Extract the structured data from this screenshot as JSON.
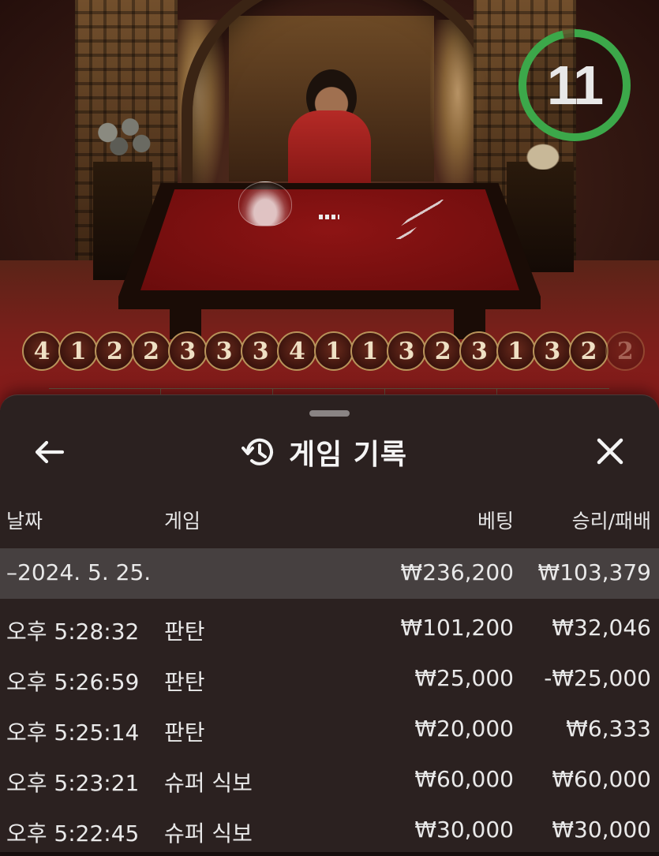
{
  "timer": {
    "value": "11",
    "color": "#3ca84a"
  },
  "road": {
    "results": [
      "4",
      "1",
      "2",
      "2",
      "3",
      "3",
      "3",
      "4",
      "1",
      "1",
      "3",
      "2",
      "3",
      "1",
      "3",
      "2",
      "2"
    ]
  },
  "panel": {
    "title": "게임 기록",
    "back_icon": "arrow-left-icon",
    "history_icon": "history-clock-icon",
    "close_icon": "close-icon",
    "columns": {
      "date": "날짜",
      "game": "게임",
      "bet": "베팅",
      "win_loss": "승리/패배"
    },
    "group": {
      "label": "–2024. 5. 25.",
      "bet": "₩236,200",
      "win_loss": "₩103,379"
    },
    "rows": [
      {
        "time": "오후 5:28:32",
        "game": "판탄",
        "bet": "₩101,200",
        "win_loss": "₩32,046"
      },
      {
        "time": "오후 5:26:59",
        "game": "판탄",
        "bet": "₩25,000",
        "win_loss": "-₩25,000"
      },
      {
        "time": "오후 5:25:14",
        "game": "판탄",
        "bet": "₩20,000",
        "win_loss": "₩6,333"
      },
      {
        "time": "오후 5:23:21",
        "game": "슈퍼 식보",
        "bet": "₩60,000",
        "win_loss": "₩60,000"
      },
      {
        "time": "오후 5:22:45",
        "game": "슈퍼 식보",
        "bet": "₩30,000",
        "win_loss": "₩30,000"
      }
    ]
  }
}
